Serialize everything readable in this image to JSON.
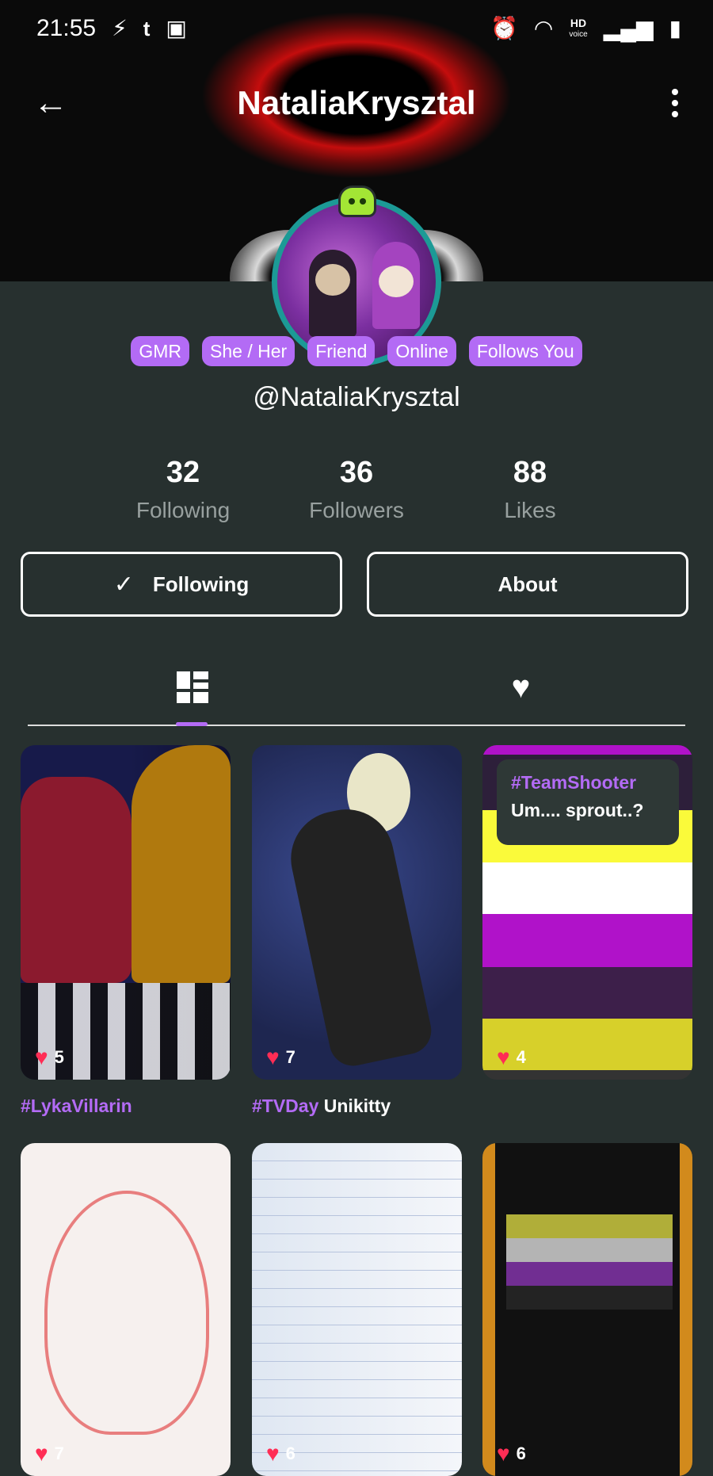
{
  "statusbar": {
    "time": "21:55",
    "icons": [
      "lightning-icon",
      "tumblr-icon",
      "image-icon"
    ],
    "right_icons": [
      "alarm-icon",
      "wifi-icon",
      "hd-voice-icon",
      "signal-icon",
      "battery-icon"
    ],
    "hd_top": "HD",
    "hd_bottom": "voice"
  },
  "header": {
    "title": "NataliaKrysztal"
  },
  "profile": {
    "tags": [
      "GMR",
      "She / Her",
      "Friend",
      "Online",
      "Follows You"
    ],
    "handle": "@NataliaKrysztal",
    "stats": [
      {
        "value": "32",
        "label": "Following"
      },
      {
        "value": "36",
        "label": "Followers"
      },
      {
        "value": "88",
        "label": "Likes"
      }
    ]
  },
  "actions": {
    "following_label": "Following",
    "about_label": "About"
  },
  "tabs": {
    "active": "posts",
    "items": [
      "posts-grid-icon",
      "liked-heart-icon"
    ]
  },
  "posts": [
    {
      "likes": "5",
      "caption_tag": "#LykaVillarin",
      "caption_text": ""
    },
    {
      "likes": "7",
      "caption_tag": "#TVDay",
      "caption_text": "Unikitty"
    },
    {
      "likes": "4",
      "overlay_tag": "#TeamShooter",
      "overlay_text": "Um.... sprout..?"
    },
    {
      "likes": "7"
    },
    {
      "likes": "6"
    },
    {
      "likes": "6"
    }
  ],
  "colors": {
    "background": "#27302f",
    "accent": "#b36bf5",
    "heart": "#ff2d55",
    "avatar_ring": "#1c9a96"
  }
}
